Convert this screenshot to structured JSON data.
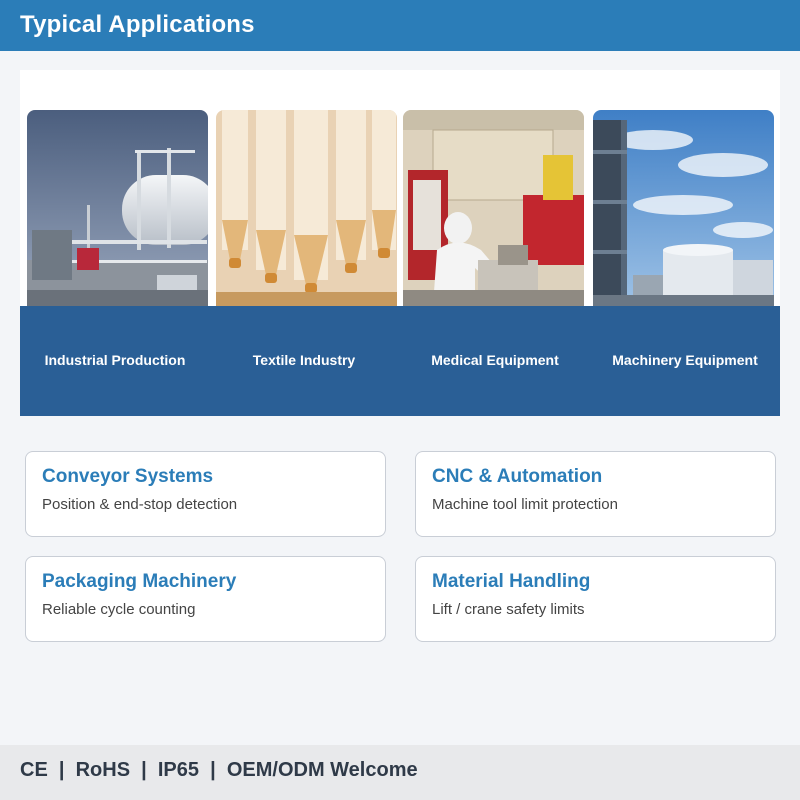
{
  "header": {
    "title": "Typical Applications"
  },
  "applications": [
    {
      "label": "Industrial Production",
      "image": "industrial-plant-photo"
    },
    {
      "label": "Textile Industry",
      "image": "textile-spindles-photo"
    },
    {
      "label": "Medical Equipment",
      "image": "lab-technician-photo"
    },
    {
      "label": "Machinery Equipment",
      "image": "refinery-tower-photo"
    }
  ],
  "cards": [
    {
      "title": "Conveyor Systems",
      "desc": "Position & end-stop detection"
    },
    {
      "title": "CNC & Automation",
      "desc": "Machine tool limit protection"
    },
    {
      "title": "Packaging Machinery",
      "desc": "Reliable cycle counting"
    },
    {
      "title": "Material Handling",
      "desc": "Lift / crane safety limits"
    }
  ],
  "footer": {
    "certifications": "CE  |  RoHS  |  IP65  |  OEM/ODM Welcome"
  },
  "colors": {
    "header_bg": "#2b7db8",
    "band_bg": "#2a5f96",
    "card_title": "#2b7db8",
    "footer_bg": "#e8e9eb"
  }
}
